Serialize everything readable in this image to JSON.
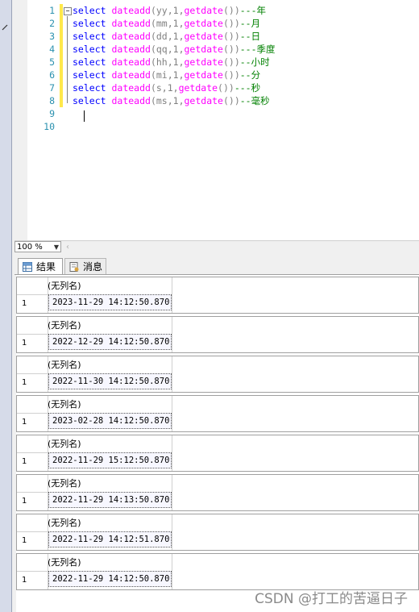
{
  "editor": {
    "lines": [
      {
        "num": "1",
        "kw": "select",
        "fn": "dateadd",
        "args": "(yy,1,",
        "fn2": "getdate",
        "tail": "())",
        "comment": "---年"
      },
      {
        "num": "2",
        "kw": "select",
        "fn": "dateadd",
        "args": "(mm,1,",
        "fn2": "getdate",
        "tail": "())",
        "comment": "--月"
      },
      {
        "num": "3",
        "kw": "select",
        "fn": "dateadd",
        "args": "(dd,1,",
        "fn2": "getdate",
        "tail": "())",
        "comment": "--日"
      },
      {
        "num": "4",
        "kw": "select",
        "fn": "dateadd",
        "args": "(qq,1,",
        "fn2": "getdate",
        "tail": "())",
        "comment": "---季度"
      },
      {
        "num": "5",
        "kw": "select",
        "fn": "dateadd",
        "args": "(hh,1,",
        "fn2": "getdate",
        "tail": "())",
        "comment": "--小时"
      },
      {
        "num": "6",
        "kw": "select",
        "fn": "dateadd",
        "args": "(mi,1,",
        "fn2": "getdate",
        "tail": "())",
        "comment": "--分"
      },
      {
        "num": "7",
        "kw": "select",
        "fn": "dateadd",
        "args": "(s,1,",
        "fn2": "getdate",
        "tail": "())",
        "comment": "---秒"
      },
      {
        "num": "8",
        "kw": "select",
        "fn": "dateadd",
        "args": "(ms,1,",
        "fn2": "getdate",
        "tail": "())",
        "comment": "--毫秒"
      },
      {
        "num": "9",
        "kw": "",
        "fn": "",
        "args": "",
        "fn2": "",
        "tail": "",
        "comment": ""
      },
      {
        "num": "10",
        "kw": "",
        "fn": "",
        "args": "",
        "fn2": "",
        "tail": "",
        "comment": ""
      }
    ]
  },
  "zoom": {
    "value": "100 %"
  },
  "tabs": {
    "results": "结果",
    "messages": "消息"
  },
  "results": [
    {
      "header": "(无列名)",
      "row": "1",
      "value": "2023-11-29 14:12:50.870"
    },
    {
      "header": "(无列名)",
      "row": "1",
      "value": "2022-12-29 14:12:50.870"
    },
    {
      "header": "(无列名)",
      "row": "1",
      "value": "2022-11-30 14:12:50.870"
    },
    {
      "header": "(无列名)",
      "row": "1",
      "value": "2023-02-28 14:12:50.870"
    },
    {
      "header": "(无列名)",
      "row": "1",
      "value": "2022-11-29 15:12:50.870"
    },
    {
      "header": "(无列名)",
      "row": "1",
      "value": "2022-11-29 14:13:50.870"
    },
    {
      "header": "(无列名)",
      "row": "1",
      "value": "2022-11-29 14:12:51.870"
    },
    {
      "header": "(无列名)",
      "row": "1",
      "value": "2022-11-29 14:12:50.870"
    }
  ],
  "watermark": "CSDN @打工的苦逼日子"
}
